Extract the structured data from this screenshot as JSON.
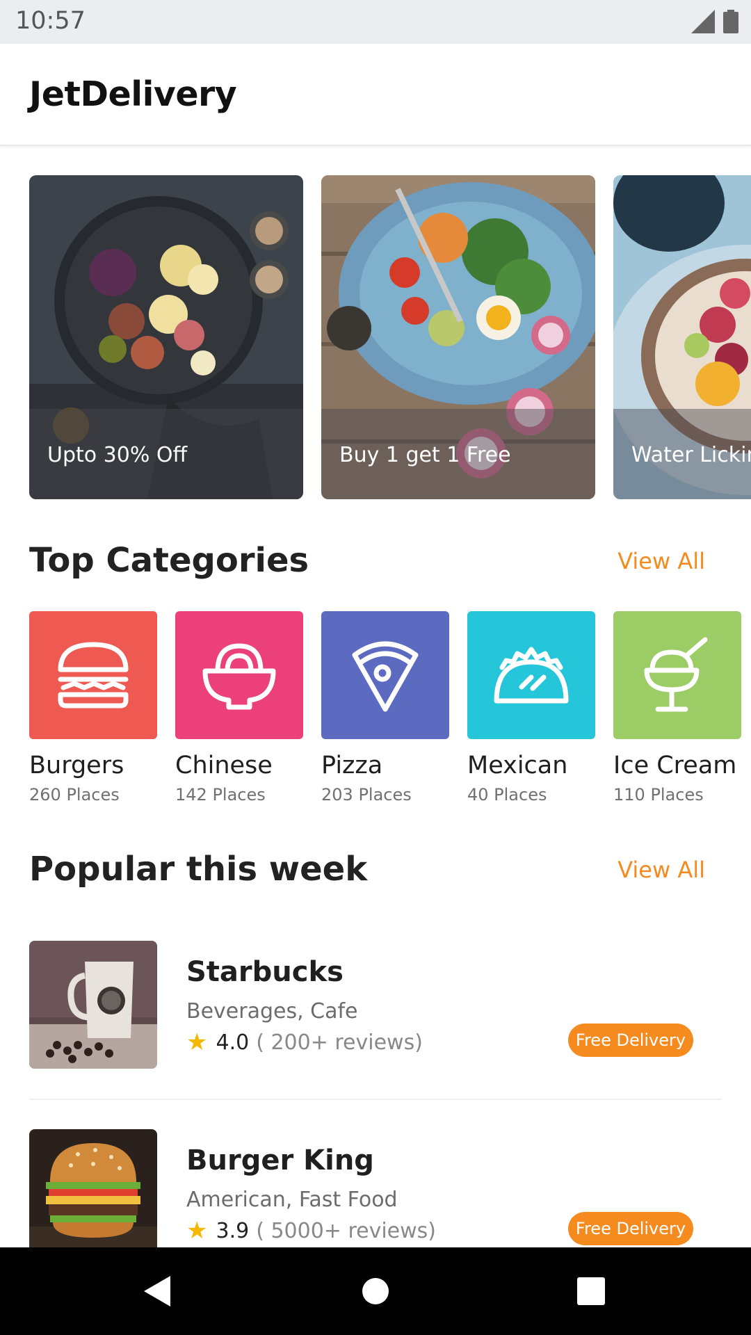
{
  "status_bar": {
    "time": "10:57"
  },
  "app_bar": {
    "title": "JetDelivery"
  },
  "banners": [
    {
      "label": "Upto 30% Off"
    },
    {
      "label": "Buy 1 get 1 Free"
    },
    {
      "label": "Water Lickin"
    }
  ],
  "top_categories": {
    "title": "Top Categories",
    "view_all": "View All",
    "items": [
      {
        "name": "Burgers",
        "count": "260 Places",
        "color": "#EE5A52",
        "icon": "burger-icon"
      },
      {
        "name": "Chinese",
        "count": "142 Places",
        "color": "#EC407A",
        "icon": "noodle-bowl-icon"
      },
      {
        "name": "Pizza",
        "count": "203 Places",
        "color": "#5C6BC0",
        "icon": "pizza-slice-icon"
      },
      {
        "name": "Mexican",
        "count": "40 Places",
        "color": "#26C6DA",
        "icon": "taco-icon"
      },
      {
        "name": "Ice Cream",
        "count": "110 Places",
        "color": "#9CCC65",
        "icon": "ice-cream-cup-icon"
      }
    ]
  },
  "popular": {
    "title": "Popular this week",
    "view_all": "View All",
    "items": [
      {
        "name": "Starbucks",
        "cuisine": "Beverages, Cafe",
        "rating": "4.0",
        "reviews": "( 200+ reviews)",
        "badge": "Free Delivery"
      },
      {
        "name": "Burger King",
        "cuisine": "American, Fast Food",
        "rating": "3.9",
        "reviews": "( 5000+ reviews)",
        "badge": "Free Delivery"
      }
    ]
  },
  "colors": {
    "accent": "#F58A1F",
    "star": "#F5B800"
  }
}
